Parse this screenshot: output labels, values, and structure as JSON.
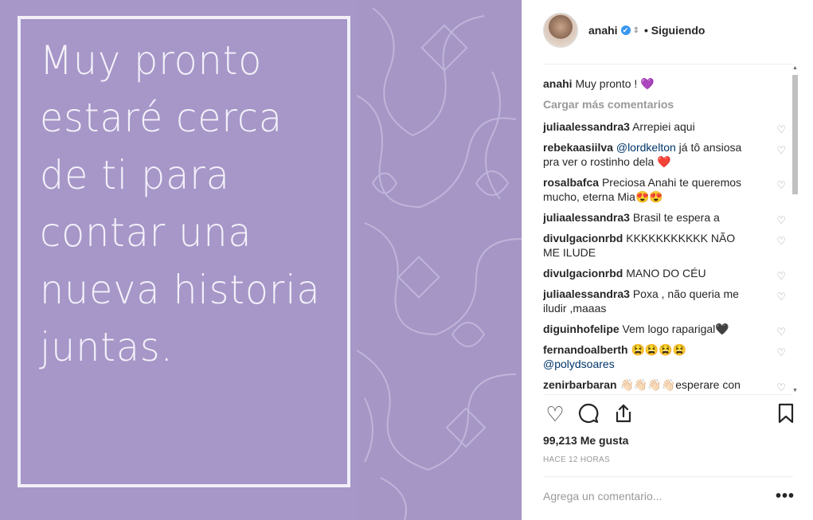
{
  "post": {
    "quote_lines": [
      "Muy pronto",
      "estaré cerca",
      "de ti para",
      "contar una",
      "nueva historia",
      "juntas."
    ]
  },
  "header": {
    "username": "anahi",
    "verified_badge": "✔",
    "separator": "•",
    "follow_status": "Siguiendo"
  },
  "caption": {
    "user": "anahi",
    "text": "Muy pronto ! 💜"
  },
  "load_more_label": "Cargar más comentarios",
  "comments": [
    {
      "user": "juliaalessandra3",
      "text": "Arrepiei aqui"
    },
    {
      "user": "rebekaasiilva",
      "mention": "@lordkelton",
      "text": " já tô ansiosa pra ver o rostinho dela ❤️"
    },
    {
      "user": "rosalbafca",
      "text": "Preciosa Anahi te queremos mucho, eterna Mia😍😍"
    },
    {
      "user": "juliaalessandra3",
      "text": "Brasil te espera a"
    },
    {
      "user": "divulgacionrbd",
      "text": "KKKKKKKKKKK NÃO ME ILUDE"
    },
    {
      "user": "divulgacionrbd",
      "text": "MANO DO CÉU"
    },
    {
      "user": "juliaalessandra3",
      "text": "Poxa , não queria me iludir ,maaas"
    },
    {
      "user": "diguinhofelipe",
      "text": "Vem logo raparigal🖤"
    },
    {
      "user": "fernandoalberth",
      "text": "😫😫😫😫",
      "mention2": "@polydsoares"
    },
    {
      "user": "zenirbarbaran",
      "text": "👋🏻👋🏻👋🏻👋🏻esperare con"
    }
  ],
  "likes_count": "99,213 Me gusta",
  "timestamp": "HACE 12 HORAS",
  "add_comment_placeholder": "Agrega un comentario...",
  "more_options": "•••",
  "icons": {
    "like": "heart-icon",
    "comment": "comment-icon",
    "share": "share-icon",
    "save": "bookmark-icon"
  },
  "colors": {
    "image_bg": "#a697c8",
    "verified": "#3897f0",
    "mention": "#003569"
  }
}
